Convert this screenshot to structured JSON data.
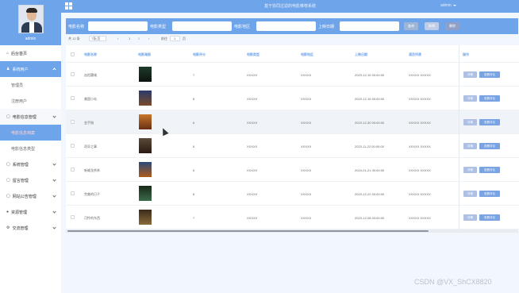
{
  "header": {
    "title": "基于协同过滤的电影推荐系统",
    "user": "admin"
  },
  "sidebar": {
    "username": "admin",
    "items": [
      {
        "label": "后台首页",
        "icon": "home-icon"
      },
      {
        "label": "系统用户",
        "icon": "user-icon"
      },
      {
        "label": "管理员"
      },
      {
        "label": "注册用户"
      },
      {
        "label": "电影信息管理",
        "icon": "document-icon"
      },
      {
        "label": "电影信息档案"
      },
      {
        "label": "电影信息类型"
      },
      {
        "label": "系统管理",
        "icon": "document-icon"
      },
      {
        "label": "留言管理",
        "icon": "document-icon"
      },
      {
        "label": "网站公告管理",
        "icon": "document-icon"
      },
      {
        "label": "资源管理",
        "icon": "location-icon"
      },
      {
        "label": "交流管理",
        "icon": "settings-icon"
      }
    ]
  },
  "search": {
    "name_label": "电影名称",
    "type_label": "电影类型",
    "region_label": "电影地区",
    "date_label": "上映日期",
    "search_btn": "查询",
    "add_btn": "新增",
    "delete_btn": "删除"
  },
  "pager": {
    "total": "共 12 条",
    "page_size": "7条/页",
    "prev": "‹",
    "page1": "1",
    "page2": "2",
    "next": "›",
    "goto_label": "前往",
    "goto_value": "1",
    "page_unit": "页"
  },
  "table": {
    "headers": [
      "电影名称",
      "电影海报",
      "电影评分",
      "电影类型",
      "电影地区",
      "上映日期",
      "演员列表",
      "操作"
    ],
    "rows": [
      {
        "name": "凶险疆域",
        "score": "7",
        "type": "XXXXX",
        "region": "XXXXX",
        "date": "2023-12-15 00:00:00",
        "actors": "XXXXX XXXXX"
      },
      {
        "name": "美国小岛",
        "score": "8",
        "type": "XXXXX",
        "region": "XXXXX",
        "date": "2023-12-15 00:00:00",
        "actors": "XXXXX XXXXX"
      },
      {
        "name": "金手指",
        "score": "6",
        "type": "XXXXX",
        "region": "XXXXX",
        "date": "2023-12-30 00:00:00",
        "actors": "XXXXX XXXXX"
      },
      {
        "name": "奇异之事",
        "score": "6",
        "type": "XXXXX",
        "region": "XXXXX",
        "date": "2023-11-22 00:00:00",
        "actors": "XXXXX XXXXX"
      },
      {
        "name": "新威龙杀阵",
        "score": "6",
        "type": "XXXXX",
        "region": "XXXXX",
        "date": "2024-01-21 00:00:00",
        "actors": "XXXXX XXXXX"
      },
      {
        "name": "完美的日子",
        "score": "8",
        "type": "XXXXX",
        "region": "XXXXX",
        "date": "2023-12-22 00:00:00",
        "actors": "XXXXX XXXXX"
      },
      {
        "name": "可怜的东西",
        "score": "7",
        "type": "XXXXX",
        "region": "XXXXX",
        "date": "2023-12-08 00:00:00",
        "actors": "XXXXX XXXXX"
      }
    ],
    "detail_btn": "详情",
    "comment_btn": "查看评论"
  },
  "watermark": "CSDN @VX_ShCX8820",
  "colors": {
    "primary": "#6ea4e9",
    "detail_btn": "#aec1e4",
    "comment_btn": "#7aa3e3"
  }
}
